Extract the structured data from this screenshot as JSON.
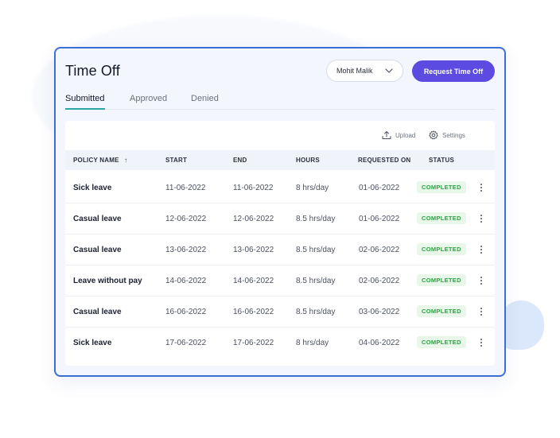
{
  "page": {
    "title": "Time Off",
    "user_select": "Mohit Malik",
    "request_button": "Request Time Off"
  },
  "tabs": [
    {
      "label": "Submitted",
      "active": true
    },
    {
      "label": "Approved",
      "active": false
    },
    {
      "label": "Denied",
      "active": false
    }
  ],
  "toolbar": {
    "upload_label": "Upload",
    "settings_label": "Settings"
  },
  "table": {
    "columns": {
      "policy": "POLICY NAME",
      "sort_indicator": "↑",
      "start": "START",
      "end": "END",
      "hours": "HOURS",
      "requested_on": "REQUESTED ON",
      "status": "STATUS"
    },
    "rows": [
      {
        "policy": "Sick leave",
        "start": "11-06-2022",
        "end": "11-06-2022",
        "hours": "8 hrs/day",
        "requested_on": "01-06-2022",
        "status": "COMPLETED"
      },
      {
        "policy": "Casual leave",
        "start": "12-06-2022",
        "end": "12-06-2022",
        "hours": "8.5 hrs/day",
        "requested_on": "01-06-2022",
        "status": "COMPLETED"
      },
      {
        "policy": "Casual leave",
        "start": "13-06-2022",
        "end": "13-06-2022",
        "hours": "8.5 hrs/day",
        "requested_on": "02-06-2022",
        "status": "COMPLETED"
      },
      {
        "policy": "Leave without pay",
        "start": "14-06-2022",
        "end": "14-06-2022",
        "hours": "8.5 hrs/day",
        "requested_on": "02-06-2022",
        "status": "COMPLETED"
      },
      {
        "policy": "Casual leave",
        "start": "16-06-2022",
        "end": "16-06-2022",
        "hours": "8.5 hrs/day",
        "requested_on": "03-06-2022",
        "status": "COMPLETED"
      },
      {
        "policy": "Sick leave",
        "start": "17-06-2022",
        "end": "17-06-2022",
        "hours": "8 hrs/day",
        "requested_on": "04-06-2022",
        "status": "COMPLETED"
      }
    ]
  },
  "colors": {
    "accent": "#5b4be0",
    "card_border": "#3b6fd4",
    "tab_underline": "#2aa7a0",
    "status_text": "#2ea043",
    "status_bg": "#e8f7ea"
  },
  "icons": {
    "user_select": "chevron-down-icon",
    "upload": "upload-icon",
    "settings": "gear-icon",
    "row_menu": "kebab-menu-icon"
  }
}
